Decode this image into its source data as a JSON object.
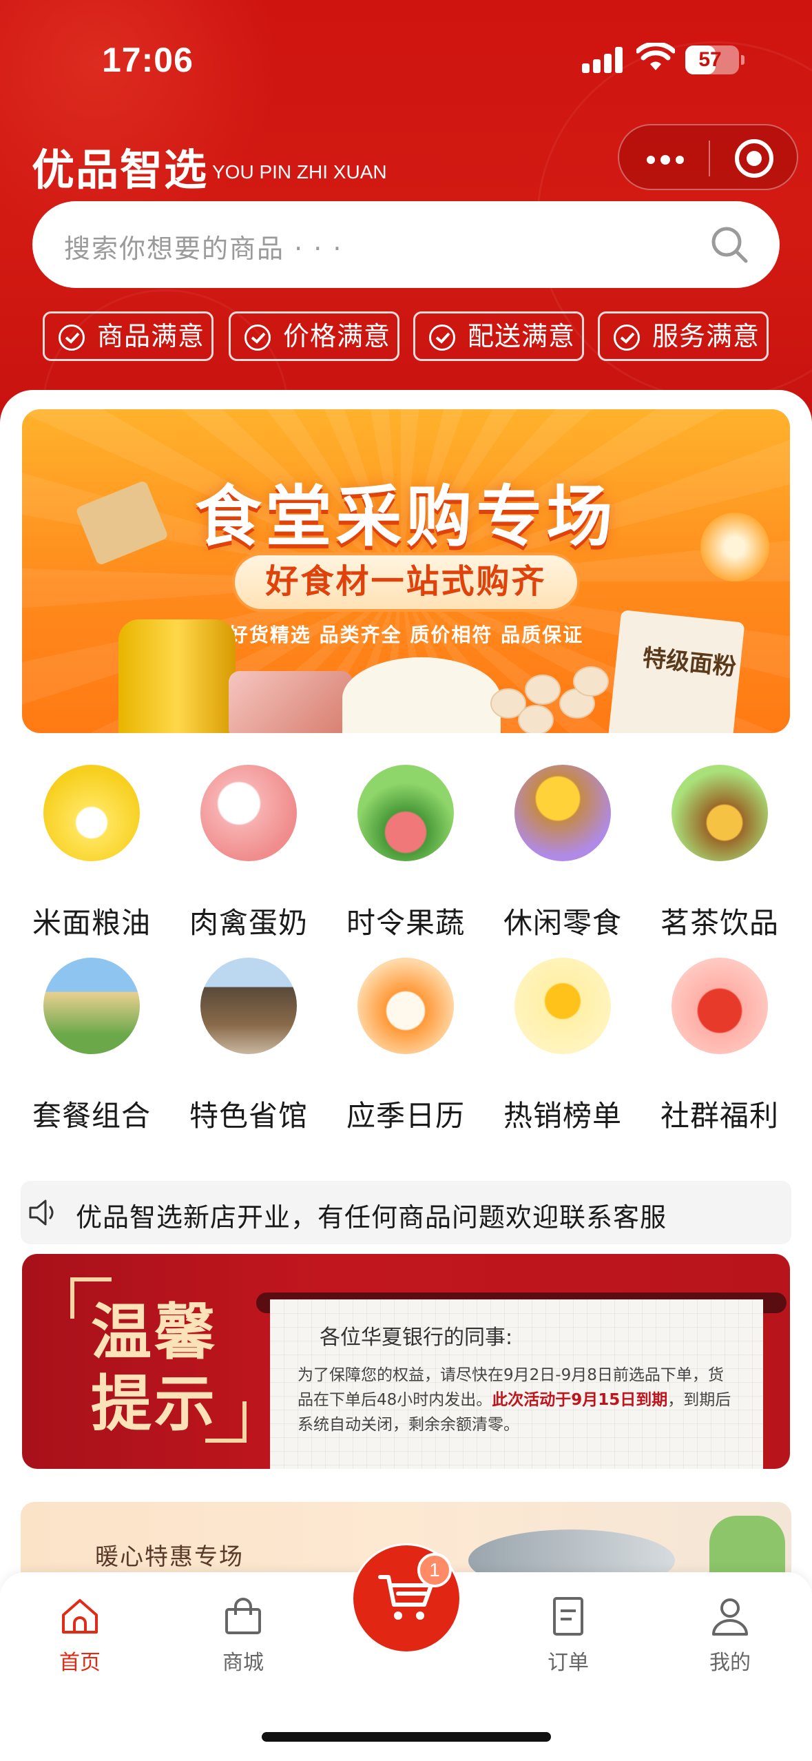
{
  "status_bar": {
    "time": "17:06",
    "battery": "57",
    "battery_fraction": 0.57
  },
  "header": {
    "brand_cn": "优品智选",
    "brand_en": "YOU PIN ZHI XUAN",
    "search_placeholder": "搜索你想要的商品 · · ·",
    "tags": [
      "商品满意",
      "价格满意",
      "配送满意",
      "服务满意"
    ]
  },
  "banner": {
    "title": "食堂采购专场",
    "pill": "好食材一站式购齐",
    "subtitle": "好货精选  品类齐全  质价相符  品质保证",
    "flour_label": "特级面粉"
  },
  "categories": [
    {
      "label": "米面粮油",
      "icon": "rice-oil-icon"
    },
    {
      "label": "肉禽蛋奶",
      "icon": "milk-egg-icon"
    },
    {
      "label": "时令果蔬",
      "icon": "fruit-veg-icon"
    },
    {
      "label": "休闲零食",
      "icon": "snack-icon"
    },
    {
      "label": "茗茶饮品",
      "icon": "tea-drink-icon"
    },
    {
      "label": "套餐组合",
      "icon": "combo-icon"
    },
    {
      "label": "特色省馆",
      "icon": "province-hall-icon"
    },
    {
      "label": "应季日历",
      "icon": "calendar-icon"
    },
    {
      "label": "热销榜单",
      "icon": "trophy-icon"
    },
    {
      "label": "社群福利",
      "icon": "lucky-bag-icon"
    }
  ],
  "notice": {
    "text": "优品智选新店开业，有任何商品问题欢迎联系客服"
  },
  "tip": {
    "title_line1": "温馨",
    "title_line2": "提示",
    "greeting": "各位华夏银行的同事:",
    "body_pre": "为了保障您的权益，请尽快在9月2日-9月8日前选品下单，货品在下单后48小时内发出。",
    "body_highlight": "此次活动于9月15日到期",
    "body_post": "，到期后系统自动关闭，剩余余额清零。"
  },
  "promo": {
    "title": "暖心特惠专场"
  },
  "tabbar": {
    "home": "首页",
    "mall": "商城",
    "orders": "订单",
    "mine": "我的",
    "cart_count": "1"
  },
  "colors": {
    "brand_red": "#d21a12",
    "active_tab": "#e02b16",
    "banner_orange": "#ff8a1c"
  }
}
